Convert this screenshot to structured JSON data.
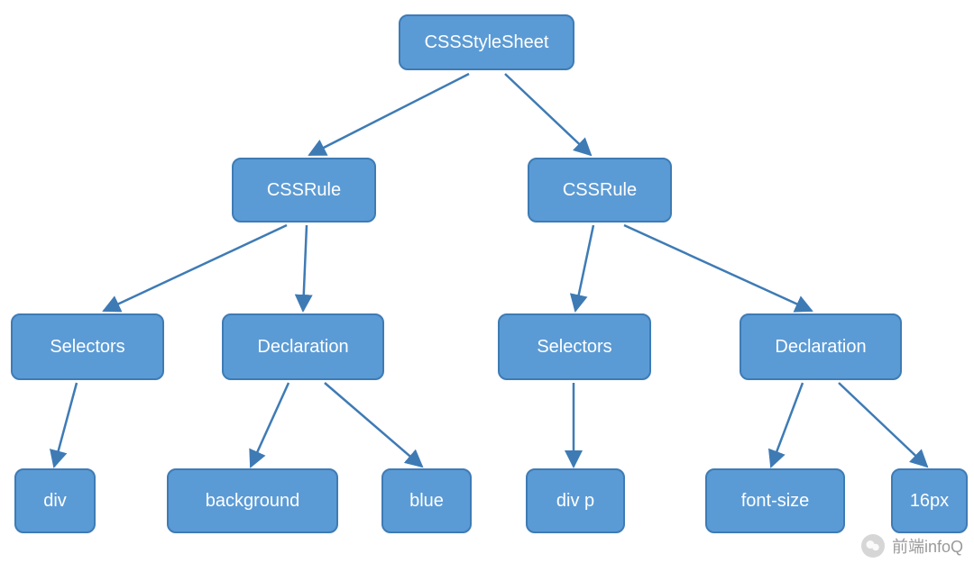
{
  "diagram": {
    "root": "CSSStyleSheet",
    "level1": {
      "rule1": "CSSRule",
      "rule2": "CSSRule"
    },
    "level2": {
      "selectors1": "Selectors",
      "declaration1": "Declaration",
      "selectors2": "Selectors",
      "declaration2": "Declaration"
    },
    "level3": {
      "div": "div",
      "background": "background",
      "blue": "blue",
      "divp": "div p",
      "fontsize": "font-size",
      "sixteenpx": "16px"
    }
  },
  "colors": {
    "nodeFill": "#5b9bd5",
    "nodeBorder": "#3e7bb5",
    "edge": "#3e7bb5"
  },
  "watermark": {
    "text": "前端infoQ"
  }
}
